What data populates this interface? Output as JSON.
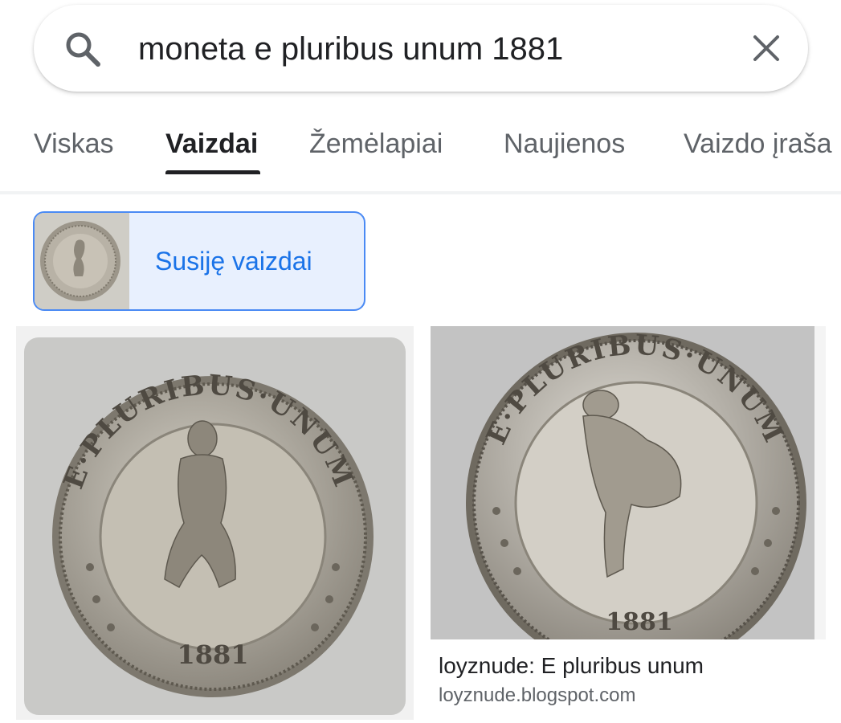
{
  "search": {
    "query": "moneta e pluribus unum 1881"
  },
  "tabs": [
    {
      "label": "Viskas",
      "active": false
    },
    {
      "label": "Vaizdai",
      "active": true
    },
    {
      "label": "Žemėlapiai",
      "active": false
    },
    {
      "label": "Naujienos",
      "active": false
    },
    {
      "label": "Vaizdo įraša",
      "active": false
    }
  ],
  "related": {
    "label": "Susiję vaizdai"
  },
  "results": [
    {
      "coin_legend": "E·PLURIBUS·UNUM",
      "coin_year": "1881"
    },
    {
      "coin_legend": "E·PLURIBUS·UNUM",
      "coin_year": "1881",
      "title": "loyznude: E pluribus unum",
      "source": "loyznude.blogspot.com"
    }
  ],
  "colors": {
    "accent": "#1a73e8",
    "chip_bg": "#e8f0fe",
    "chip_border": "#4a8af4",
    "text_primary": "#202124",
    "text_secondary": "#5f6368"
  }
}
